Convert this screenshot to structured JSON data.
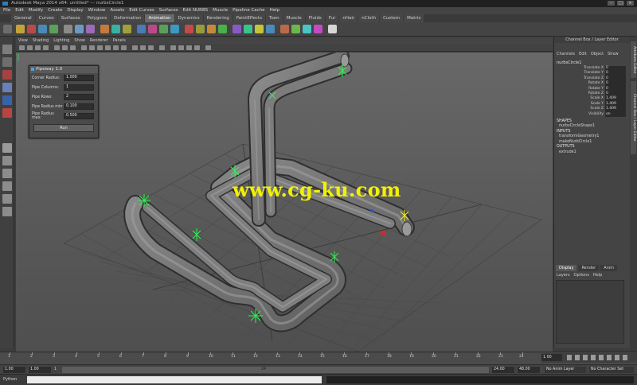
{
  "window": {
    "title": "Autodesk Maya 2014 x64: untitled*  ---  nurbsCircle1",
    "controls": [
      "–",
      "□",
      "×"
    ]
  },
  "menubar": [
    "File",
    "Edit",
    "Modify",
    "Create",
    "Display",
    "Window",
    "Assets",
    "Edit Curves",
    "Surfaces",
    "Edit NURBS",
    "Muscle",
    "Pipeline Cache",
    "Help"
  ],
  "shelf_tabs": {
    "items": [
      "General",
      "Curves",
      "Surfaces",
      "Polygons",
      "Deformation",
      "Animation",
      "Dynamics",
      "Rendering",
      "PaintEffects",
      "Toon",
      "Muscle",
      "Fluids",
      "Fur",
      "nHair",
      "nCloth",
      "Custom",
      "Matrix"
    ],
    "active": "Animation"
  },
  "viewport": {
    "menu": [
      "View",
      "Shading",
      "Lighting",
      "Show",
      "Renderer",
      "Panels"
    ],
    "watermark": "www.cg-ku.com",
    "background": "#5f5f5f",
    "pipe_color": "#7a7a7a",
    "locator_color": "#33ee55"
  },
  "pipeway": {
    "title": "Pipeway 1.0",
    "fields": [
      {
        "label": "Corner Radius:",
        "value": "1.000"
      },
      {
        "label": "Pipe Columns:",
        "value": "1"
      },
      {
        "label": "Pipe Rows:",
        "value": "2"
      },
      {
        "label": "Pipe Radius min:",
        "value": "0.100"
      },
      {
        "label": "Pipe Radius max:",
        "value": "0.500"
      }
    ],
    "run_label": "Run"
  },
  "channel_box": {
    "title": "Channel Box / Layer Editor",
    "menu": [
      "Channels",
      "Edit",
      "Object",
      "Show"
    ],
    "object": "nurbsCircle1",
    "attributes": [
      {
        "name": "Translate X",
        "value": "0"
      },
      {
        "name": "Translate Y",
        "value": "0"
      },
      {
        "name": "Translate Z",
        "value": "0"
      },
      {
        "name": "Rotate X",
        "value": "0"
      },
      {
        "name": "Rotate Y",
        "value": "0"
      },
      {
        "name": "Rotate Z",
        "value": "0"
      },
      {
        "name": "Scale X",
        "value": "1.409"
      },
      {
        "name": "Scale Y",
        "value": "1.409"
      },
      {
        "name": "Scale Z",
        "value": "1.409"
      },
      {
        "name": "Visibility",
        "value": "on"
      }
    ],
    "shapes_header": "SHAPES",
    "shapes": [
      "nurbsCircleShape1"
    ],
    "inputs_header": "INPUTS",
    "inputs": [
      "transformGeometry1",
      "makeNurbCircle1"
    ],
    "outputs_header": "OUTPUTS",
    "outputs": [
      "extrude1"
    ]
  },
  "side_tabs": [
    "Attribute Editor",
    "Channel Box / Layer Editor"
  ],
  "layer_editor": {
    "tabs": [
      "Display",
      "Render",
      "Anim"
    ],
    "active": "Display",
    "menu": [
      "Layers",
      "Options",
      "Help"
    ]
  },
  "time_slider": {
    "ticks": [
      "1",
      "2",
      "3",
      "4",
      "5",
      "6",
      "7",
      "8",
      "9",
      "10",
      "11",
      "12",
      "13",
      "14",
      "15",
      "16",
      "17",
      "18",
      "19",
      "20",
      "21",
      "22",
      "23",
      "24"
    ],
    "current_frame": "1.00"
  },
  "range": {
    "start": "1.00",
    "playback_start": "1.00",
    "range_mark": "1",
    "slider_end_label": "24",
    "playback_end": "24.00",
    "end": "48.00",
    "anim_layer": "No Anim Layer",
    "character_set": "No Character Set"
  },
  "command_line": {
    "language": "Python"
  }
}
